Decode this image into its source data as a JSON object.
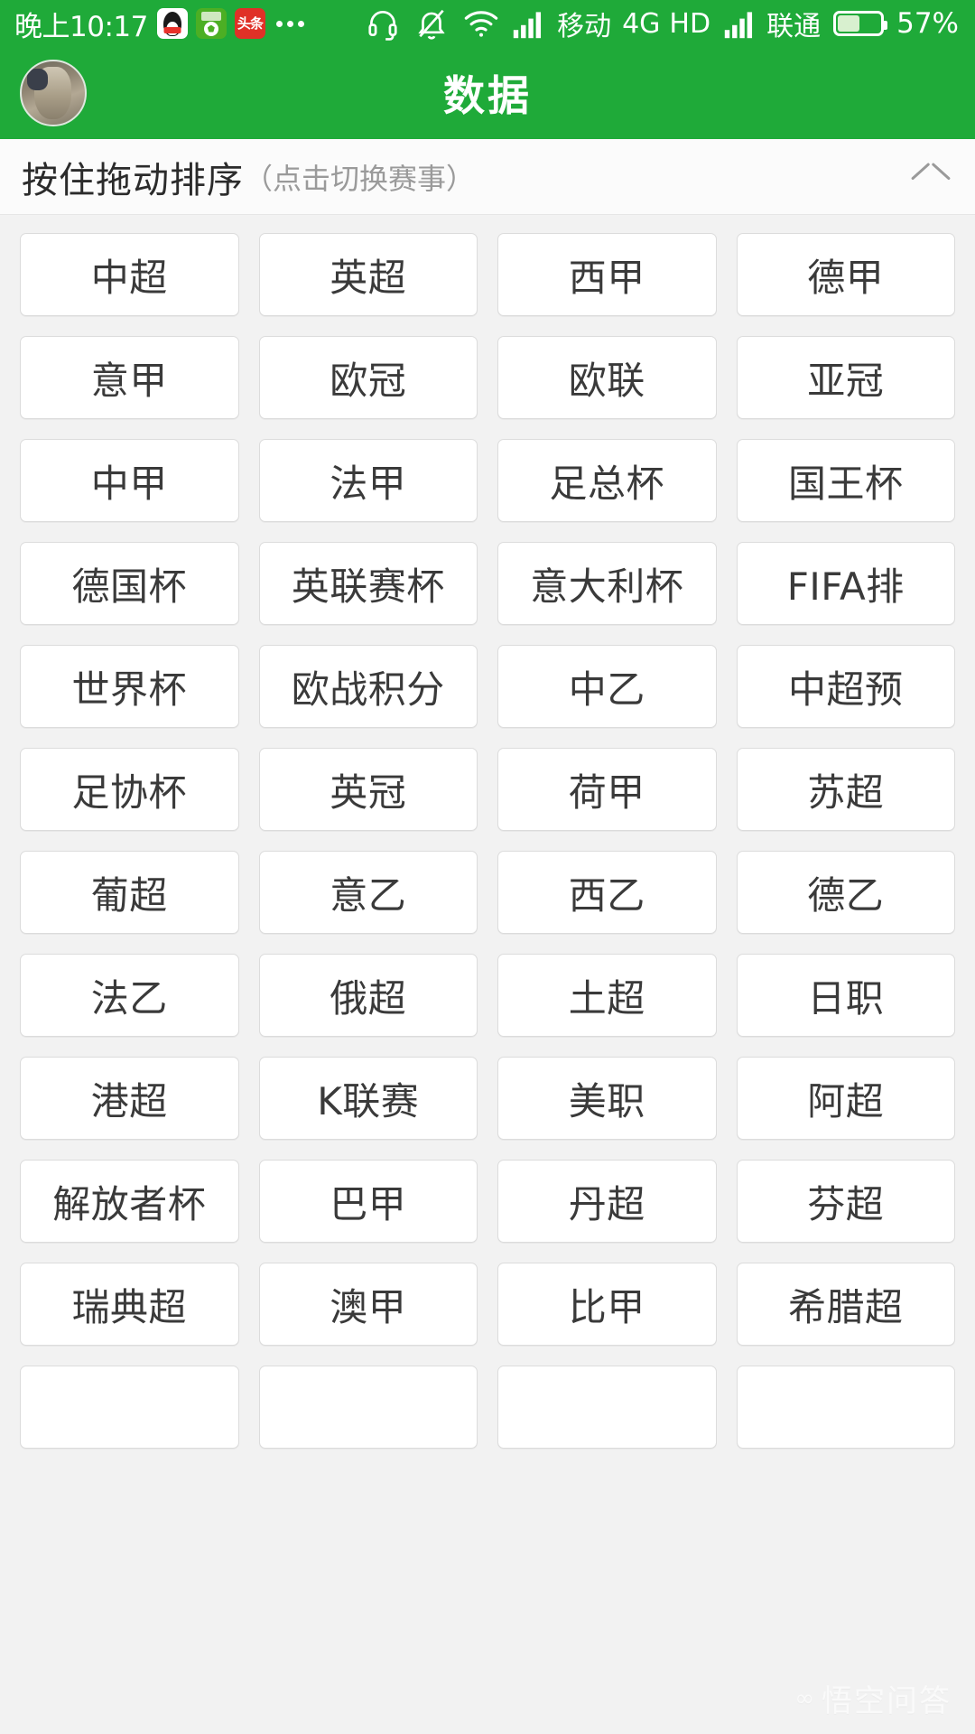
{
  "status_bar": {
    "time": "晚上10:17",
    "app_icons": [
      "qq-icon",
      "green-ball-app-icon",
      "toutiao-icon"
    ],
    "toutiao_label": "头条",
    "overflow_icon": "more-dots-icon",
    "headset_icon": "headset-icon",
    "mute_bell_icon": "bell-muted-icon",
    "wifi_icon": "wifi-icon",
    "signal1_icon": "signal-bars-icon",
    "carrier1": "移动",
    "network_type": "4G",
    "hd": "HD",
    "signal2_icon": "signal-bars-icon",
    "carrier2": "联通",
    "battery_icon": "battery-icon",
    "battery_percent": "57%"
  },
  "app_bar": {
    "avatar_icon": "user-avatar",
    "title": "数据"
  },
  "section_header": {
    "main_text": "按住拖动排序",
    "sub_text": "（点击切换赛事）",
    "collapse_icon": "chevron-up-icon"
  },
  "grid": {
    "columns": 4,
    "items": [
      "中超",
      "英超",
      "西甲",
      "德甲",
      "意甲",
      "欧冠",
      "欧联",
      "亚冠",
      "中甲",
      "法甲",
      "足总杯",
      "国王杯",
      "德国杯",
      "英联赛杯",
      "意大利杯",
      "FIFA排",
      "世界杯",
      "欧战积分",
      "中乙",
      "中超预",
      "足协杯",
      "英冠",
      "荷甲",
      "苏超",
      "葡超",
      "意乙",
      "西乙",
      "德乙",
      "法乙",
      "俄超",
      "土超",
      "日职",
      "港超",
      "K联赛",
      "美职",
      "阿超",
      "解放者杯",
      "巴甲",
      "丹超",
      "芬超",
      "瑞典超",
      "澳甲",
      "比甲",
      "希腊超",
      "",
      "",
      "",
      ""
    ]
  },
  "watermark": {
    "mark": "∞",
    "text": "悟空问答"
  },
  "colors": {
    "brand_green": "#1faa39",
    "page_bg": "#f2f2f2",
    "cell_bg": "#ffffff",
    "cell_border": "#dcdcdc",
    "text_primary": "#3a3a3a",
    "text_muted": "#9a9a9a"
  }
}
